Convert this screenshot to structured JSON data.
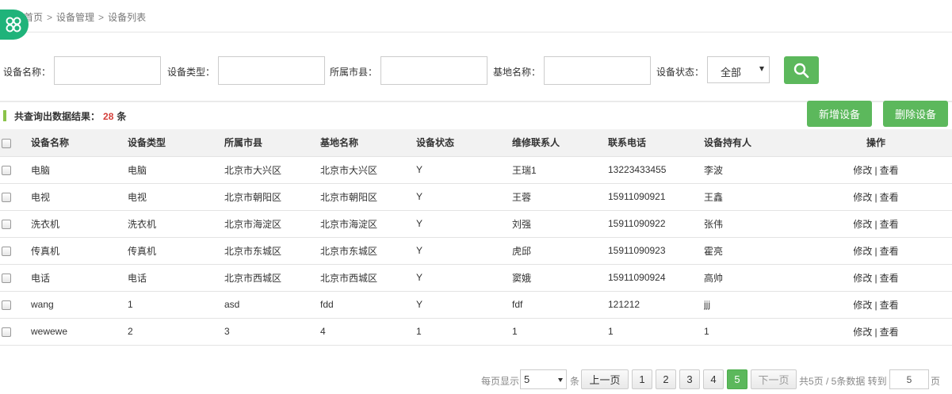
{
  "breadcrumb": {
    "items": [
      "首页",
      "设备管理",
      "设备列表"
    ],
    "sep": ">"
  },
  "search": {
    "fields": [
      {
        "label": "设备名称：",
        "value": ""
      },
      {
        "label": "设备类型：",
        "value": ""
      },
      {
        "label": "所属市县：",
        "value": ""
      },
      {
        "label": "基地名称：",
        "value": ""
      }
    ],
    "status_label": "设备状态：",
    "status_value": "全部",
    "button_icon": "search-icon"
  },
  "result": {
    "prefix": "共查询出数据结果：",
    "count": "28",
    "suffix": "条"
  },
  "actions": {
    "add": "新增设备",
    "delete": "删除设备"
  },
  "table": {
    "headers": [
      "设备名称",
      "设备类型",
      "所属市县",
      "基地名称",
      "设备状态",
      "维修联系人",
      "联系电话",
      "设备持有人",
      "操作"
    ],
    "ops": {
      "edit": "修改",
      "sep": "|",
      "view": "查看"
    },
    "rows": [
      [
        "电脑",
        "电脑",
        "北京市大兴区",
        "北京市大兴区",
        "Y",
        "王瑞1",
        "13223433455",
        "李波"
      ],
      [
        "电视",
        "电视",
        "北京市朝阳区",
        "北京市朝阳区",
        "Y",
        "王蓉",
        "15911090921",
        "王鑫"
      ],
      [
        "洗衣机",
        "洗衣机",
        "北京市海淀区",
        "北京市海淀区",
        "Y",
        "刘强",
        "15911090922",
        "张伟"
      ],
      [
        "传真机",
        "传真机",
        "北京市东城区",
        "北京市东城区",
        "Y",
        "虎邱",
        "15911090923",
        "霍亮"
      ],
      [
        "电话",
        "电话",
        "北京市西城区",
        "北京市西城区",
        "Y",
        "窦娥",
        "15911090924",
        "高帅"
      ],
      [
        "wang",
        "1",
        "asd",
        "fdd",
        "Y",
        "fdf",
        "121212",
        "jjj"
      ],
      [
        "wewewe",
        "2",
        "3",
        "4",
        "1",
        "1",
        "1",
        "1"
      ]
    ]
  },
  "pager": {
    "per_page_label": "每页显示",
    "per_page_value": "5",
    "per_page_unit": "条",
    "prev": "上一页",
    "pages": [
      "1",
      "2",
      "3",
      "4",
      "5"
    ],
    "current": "5",
    "next": "下一页",
    "summary": "共5页 / 5条数据 转到",
    "jump_value": "5",
    "jump_unit": "页"
  },
  "colors": {
    "accent": "#5cb85c",
    "logo": "#1fb37a",
    "count": "#d43f3a",
    "result_bar": "#8bc34a"
  }
}
